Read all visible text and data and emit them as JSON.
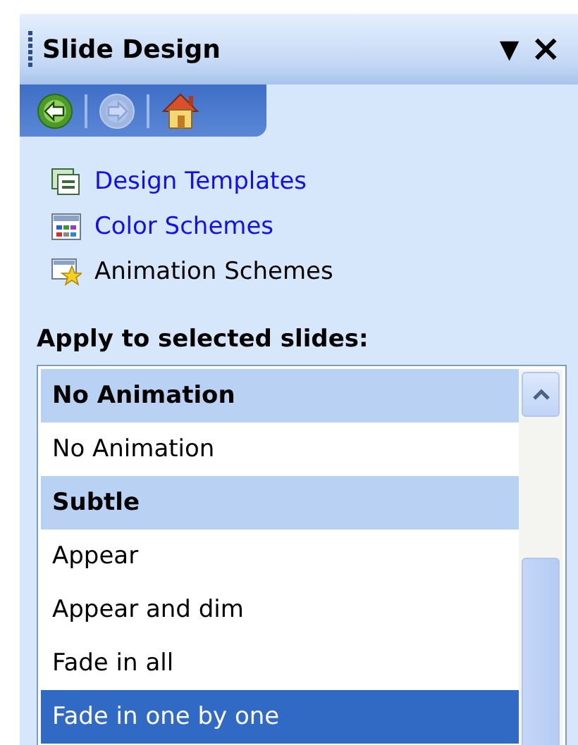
{
  "panel": {
    "title": "Slide Design",
    "menu_glyph": "▼",
    "close_glyph": "×"
  },
  "nav": [
    {
      "kind": "back",
      "disabled": false
    },
    {
      "kind": "forward",
      "disabled": true
    },
    {
      "kind": "home",
      "disabled": false
    }
  ],
  "links": [
    {
      "kind": "templates",
      "label": "Design Templates",
      "selected": false
    },
    {
      "kind": "colors",
      "label": "Color Schemes",
      "selected": false
    },
    {
      "kind": "animation",
      "label": "Animation Schemes",
      "selected": true
    }
  ],
  "apply_label": "Apply to selected slides:",
  "list": [
    {
      "kind": "header",
      "label": "No Animation"
    },
    {
      "kind": "item",
      "label": "No Animation",
      "selected": false
    },
    {
      "kind": "header",
      "label": "Subtle"
    },
    {
      "kind": "item",
      "label": "Appear",
      "selected": false
    },
    {
      "kind": "item",
      "label": "Appear and dim",
      "selected": false
    },
    {
      "kind": "item",
      "label": "Fade in all",
      "selected": false
    },
    {
      "kind": "item",
      "label": "Fade in one by one",
      "selected": true
    }
  ]
}
